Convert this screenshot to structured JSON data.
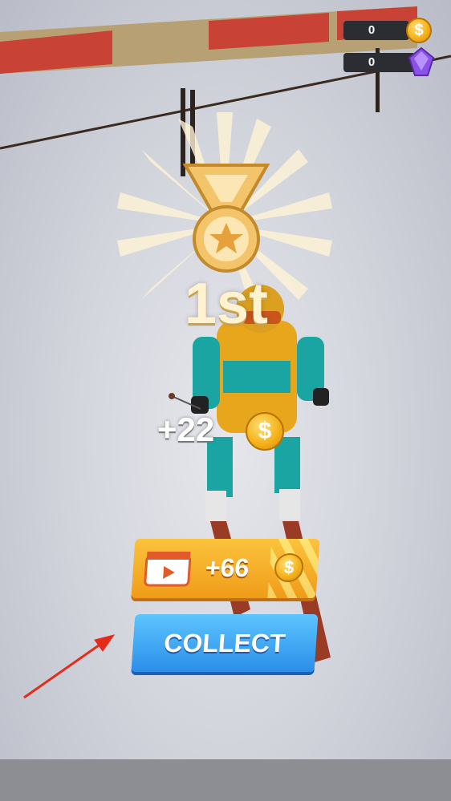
{
  "hud": {
    "coins": "0",
    "gems": "0",
    "coin_icon": "coin-icon",
    "gem_icon": "gem-icon"
  },
  "result": {
    "rank": "1st",
    "medal_icon": "medal-icon"
  },
  "reward": {
    "amount": "+22"
  },
  "ad_bonus": {
    "amount": "+66",
    "icon": "video-ad-icon"
  },
  "collect_button": {
    "label": "COLLECT"
  },
  "colors": {
    "gold": "#f5b31c",
    "collect_blue": "#2a8ee8",
    "ad_orange": "#f09c18",
    "arrow_red": "#e52b1c"
  }
}
